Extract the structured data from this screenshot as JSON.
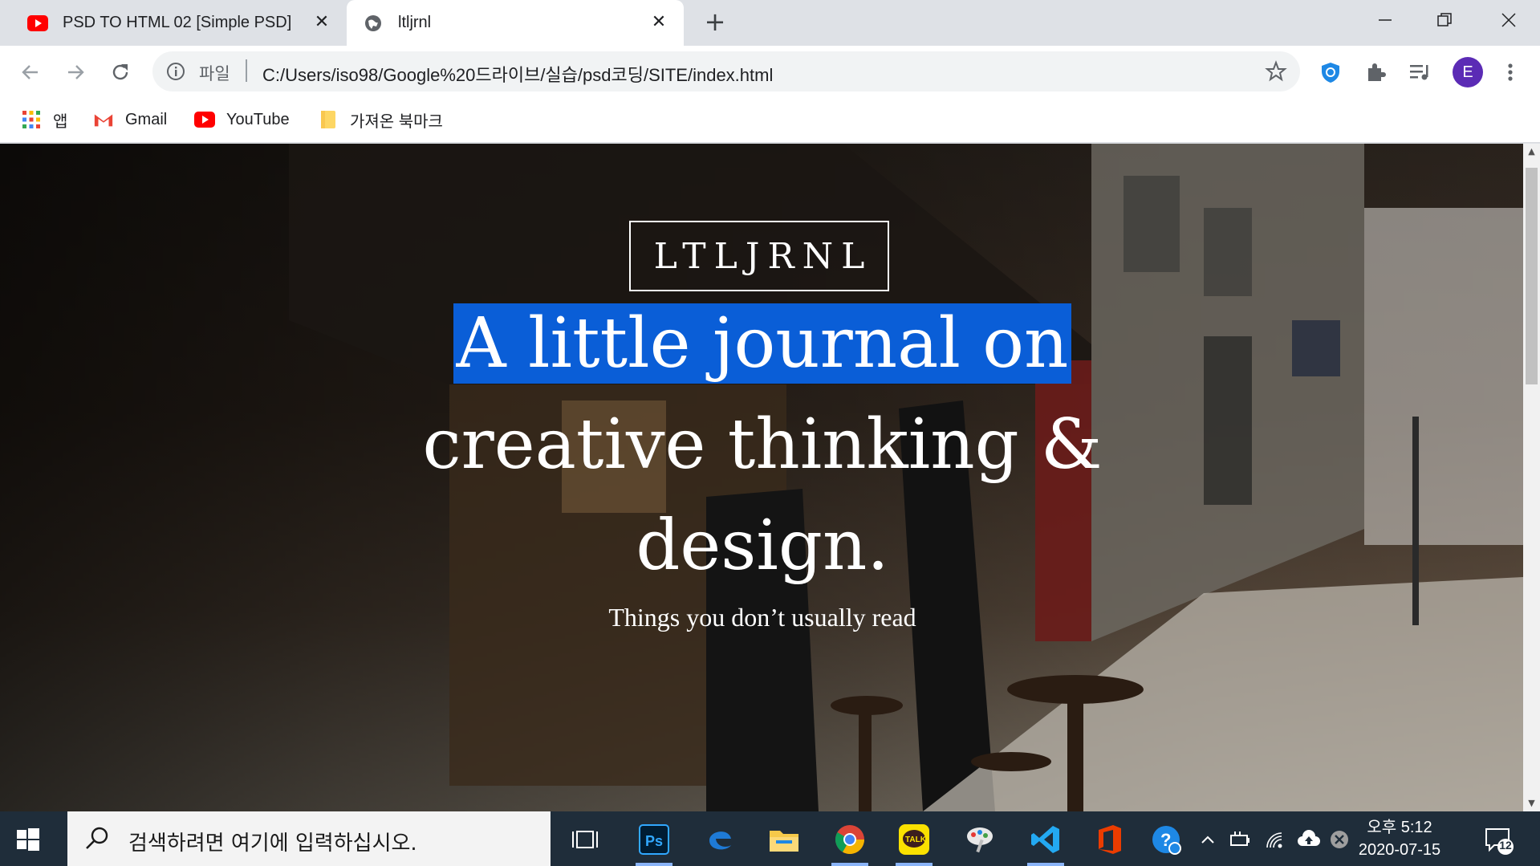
{
  "browser": {
    "tabs": [
      {
        "title": "PSD TO HTML 02 [Simple PSD]",
        "favicon": "youtube-icon",
        "active": false
      },
      {
        "title": "ltljrnl",
        "favicon": "globe-icon",
        "active": true
      }
    ],
    "address": {
      "scheme_label": "파일",
      "url": "C:/Users/iso98/Google%20드라이브/실습/psd코딩/SITE/index.html"
    },
    "profile_initial": "E",
    "bookmarks": [
      {
        "label": "앱",
        "icon": "apps-grid-icon"
      },
      {
        "label": "Gmail",
        "icon": "gmail-icon"
      },
      {
        "label": "YouTube",
        "icon": "youtube-icon"
      },
      {
        "label": "가져온 북마크",
        "icon": "folder-icon"
      }
    ]
  },
  "page": {
    "brand": "LTLJRNL",
    "headline_selected": "A little journal on",
    "headline_line2": "creative thinking &",
    "headline_line3": "design.",
    "tagline": "Things you don’t usually read"
  },
  "taskbar": {
    "search_placeholder": "검색하려면 여기에 입력하십시오.",
    "clock_time": "오후 5:12",
    "clock_date": "2020-07-15",
    "notification_count": "12",
    "apps": [
      "task-view-icon",
      "photoshop-icon",
      "edge-icon",
      "file-explorer-icon",
      "chrome-icon",
      "kakaotalk-icon",
      "paint-icon",
      "vscode-icon",
      "office-icon"
    ]
  },
  "colors": {
    "selection": "#0a5ed7",
    "taskbar": "#1f2d3a",
    "profile": "#5b2bb5"
  }
}
